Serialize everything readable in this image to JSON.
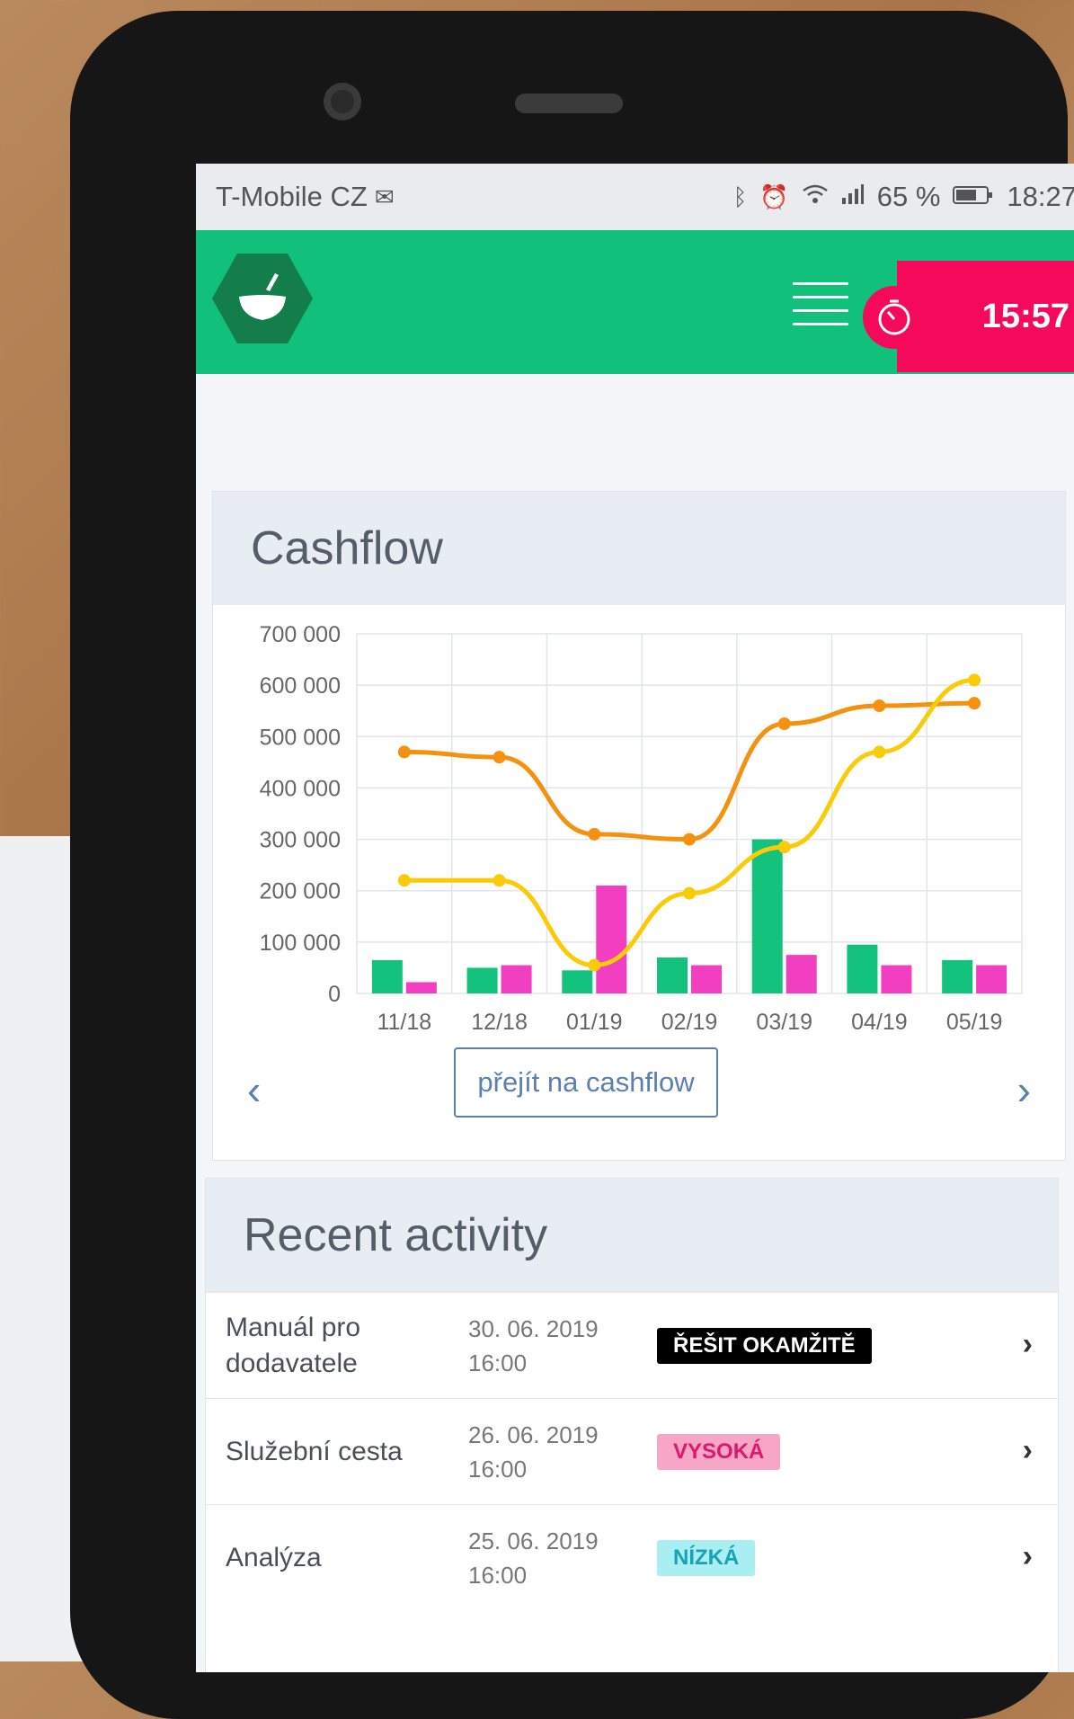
{
  "status_bar": {
    "carrier": "T-Mobile CZ",
    "icons": [
      "mail-icon",
      "bluetooth-icon",
      "alarm-icon",
      "wifi-icon",
      "signal-icon",
      "battery-icon"
    ],
    "battery": "65 %",
    "time": "18:27"
  },
  "header": {
    "timer": "15:57",
    "colors": {
      "bar": "#11c07a",
      "timer": "#f5095a",
      "logo": "#137d4c"
    }
  },
  "cashflow": {
    "title": "Cashflow",
    "button": "přejít na cashflow"
  },
  "chart_data": {
    "type": "bar",
    "categories": [
      "11/18",
      "12/18",
      "01/19",
      "02/19",
      "03/19",
      "04/19",
      "05/19"
    ],
    "y_ticks": [
      "700 000",
      "600 000",
      "500 000",
      "400 000",
      "300 000",
      "200 000",
      "100 000",
      "0"
    ],
    "ylim": [
      0,
      700000
    ],
    "grid": true,
    "bars": [
      {
        "color": "#13c27d",
        "values": [
          65000,
          50000,
          45000,
          70000,
          300000,
          95000,
          65000
        ]
      },
      {
        "color": "#f23ec0",
        "values": [
          22000,
          55000,
          210000,
          55000,
          75000,
          55000,
          55000
        ]
      }
    ],
    "lines": [
      {
        "color": "#f4920f",
        "values": [
          470000,
          460000,
          310000,
          300000,
          525000,
          560000,
          565000
        ]
      },
      {
        "color": "#fccb07",
        "values": [
          220000,
          220000,
          55000,
          195000,
          285000,
          470000,
          610000
        ]
      }
    ]
  },
  "activity": {
    "title": "Recent activity",
    "rows": [
      {
        "title": "Manuál pro dodavatele",
        "date": "30. 06. 2019",
        "time": "16:00",
        "badge": "ŘEŠIT OKAMŽITĚ"
      },
      {
        "title": "Služební cesta",
        "date": "26. 06. 2019",
        "time": "16:00",
        "badge": "VYSOKÁ"
      },
      {
        "title": "Analýza",
        "date": "25. 06. 2019",
        "time": "16:00",
        "badge": "NÍZKÁ"
      }
    ]
  }
}
